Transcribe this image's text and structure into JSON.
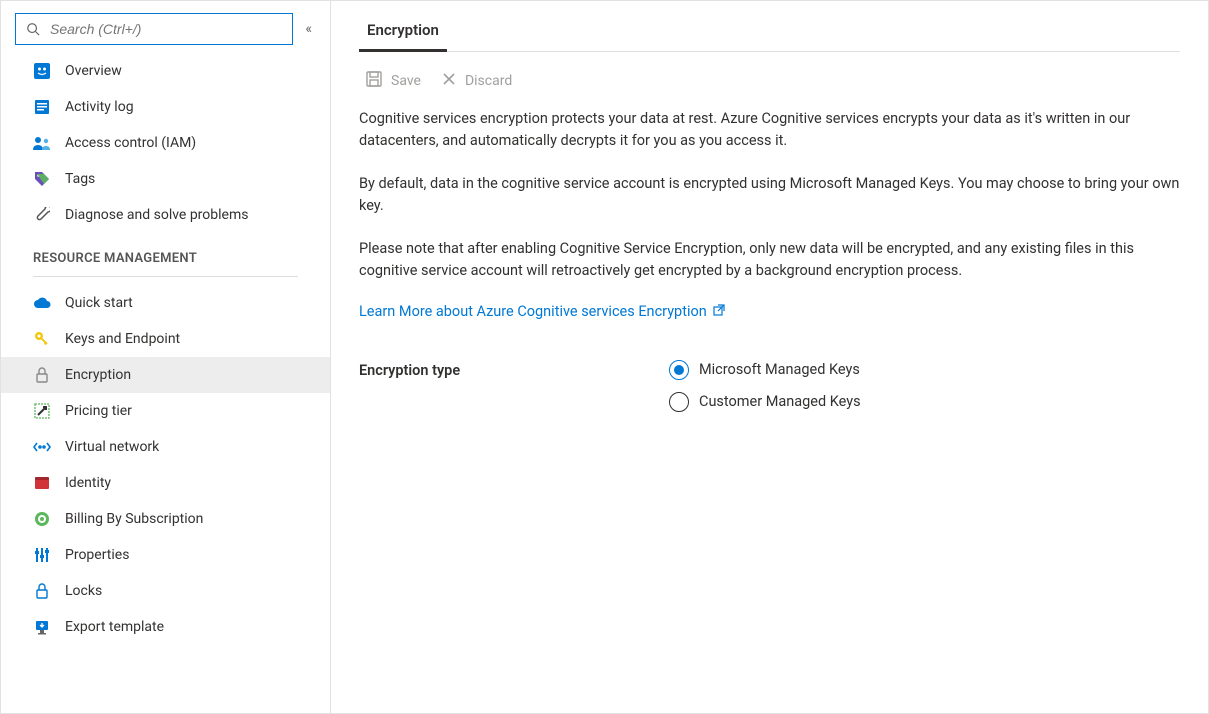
{
  "search": {
    "placeholder": "Search (Ctrl+/)"
  },
  "sidebar": {
    "top_items": [
      {
        "id": "overview",
        "label": "Overview"
      },
      {
        "id": "activity-log",
        "label": "Activity log"
      },
      {
        "id": "access-control",
        "label": "Access control (IAM)"
      },
      {
        "id": "tags",
        "label": "Tags"
      },
      {
        "id": "diagnose",
        "label": "Diagnose and solve problems"
      }
    ],
    "section_title": "RESOURCE MANAGEMENT",
    "rm_items": [
      {
        "id": "quick-start",
        "label": "Quick start"
      },
      {
        "id": "keys-endpoint",
        "label": "Keys and Endpoint"
      },
      {
        "id": "encryption",
        "label": "Encryption",
        "active": true
      },
      {
        "id": "pricing-tier",
        "label": "Pricing tier"
      },
      {
        "id": "virtual-network",
        "label": "Virtual network"
      },
      {
        "id": "identity",
        "label": "Identity"
      },
      {
        "id": "billing",
        "label": "Billing By Subscription"
      },
      {
        "id": "properties",
        "label": "Properties"
      },
      {
        "id": "locks",
        "label": "Locks"
      },
      {
        "id": "export-template",
        "label": "Export template"
      }
    ]
  },
  "main": {
    "tab": "Encryption",
    "toolbar": {
      "save": "Save",
      "discard": "Discard"
    },
    "para1": "Cognitive services encryption protects your data at rest. Azure Cognitive services encrypts your data as it's written in our datacenters, and automatically decrypts it for you as you access it.",
    "para2": "By default, data in the cognitive service account is encrypted using Microsoft Managed Keys. You may choose to bring your own key.",
    "para3": "Please note that after enabling Cognitive Service Encryption, only new data will be encrypted, and any existing files in this cognitive service account will retroactively get encrypted by a background encryption process.",
    "learn_more": "Learn More about Azure Cognitive services Encryption",
    "form": {
      "label": "Encryption type",
      "options": [
        {
          "label": "Microsoft Managed Keys",
          "selected": true
        },
        {
          "label": "Customer Managed Keys",
          "selected": false
        }
      ]
    }
  }
}
